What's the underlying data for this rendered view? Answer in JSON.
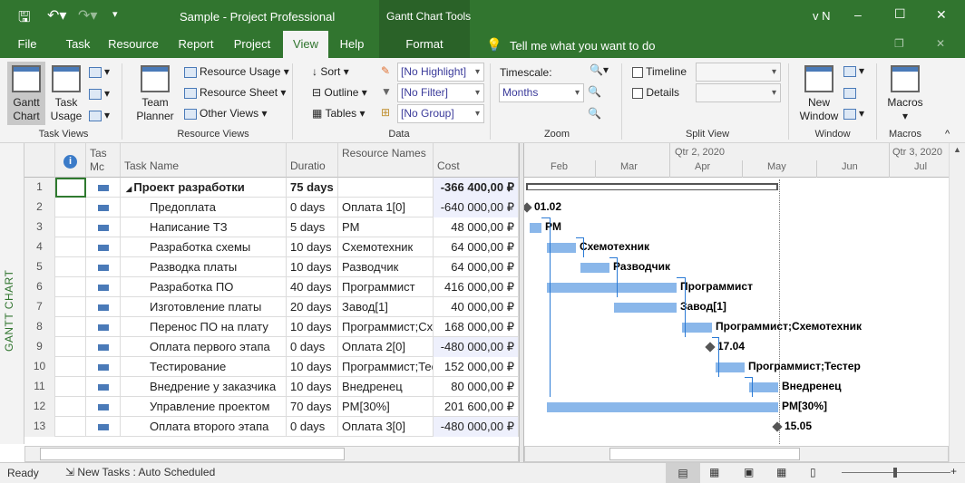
{
  "titlebar": {
    "title": "Sample  -  Project Professional",
    "context_title": "Gantt Chart Tools",
    "user": "v N",
    "minimize": "–",
    "maximize": "☐",
    "close": "✕"
  },
  "tabs": [
    {
      "label": "File"
    },
    {
      "label": "Task"
    },
    {
      "label": "Resource"
    },
    {
      "label": "Report"
    },
    {
      "label": "Project"
    },
    {
      "label": "View",
      "selected": true
    },
    {
      "label": "Help"
    },
    {
      "label": "Format"
    }
  ],
  "tell_me": "Tell me what you want to do",
  "ribbon": {
    "task_views": {
      "label": "Task Views",
      "gantt_chart": "Gantt Chart",
      "task_usage": "Task Usage"
    },
    "resource_views": {
      "label": "Resource Views",
      "team_planner": "Team Planner",
      "resource_usage": "Resource Usage",
      "resource_sheet": "Resource Sheet",
      "other_views": "Other Views"
    },
    "data": {
      "label": "Data",
      "sort": "Sort",
      "outline": "Outline",
      "tables": "Tables",
      "highlight": "[No Highlight]",
      "filter": "[No Filter]",
      "group": "[No Group]"
    },
    "zoom": {
      "label": "Zoom",
      "timescale_label": "Timescale:",
      "timescale": "Months"
    },
    "split_view": {
      "label": "Split View",
      "timeline": "Timeline",
      "details": "Details",
      "timeline_checked": false,
      "details_checked": false
    },
    "window": {
      "label": "Window",
      "new_window": "New Window"
    },
    "macros": {
      "label": "Macros",
      "macros": "Macros"
    }
  },
  "side_label": "GANTT CHART",
  "table": {
    "headers": {
      "info": "i",
      "mode": "Task Mode",
      "name": "Task Name",
      "duration": "Duration",
      "resources": "Resource Names",
      "cost": "Cost"
    },
    "header_display": {
      "mode": "Tas Mc",
      "duration": "Duratio",
      "resources": "Resource Names"
    },
    "rows": [
      {
        "id": "1",
        "name": "Проект разработки",
        "duration": "75 days",
        "resources": "",
        "cost": "-366 400,00 ₽",
        "summary": true
      },
      {
        "id": "2",
        "name": "Предоплата",
        "duration": "0 days",
        "resources": "Оплата 1[0]",
        "cost": "-640 000,00 ₽"
      },
      {
        "id": "3",
        "name": "Написание ТЗ",
        "duration": "5 days",
        "resources": "PM",
        "cost": "48 000,00 ₽"
      },
      {
        "id": "4",
        "name": "Разработка схемы",
        "duration": "10 days",
        "resources": "Схемотехник",
        "cost": "64 000,00 ₽"
      },
      {
        "id": "5",
        "name": "Разводка платы",
        "duration": "10 days",
        "resources": "Разводчик",
        "cost": "64 000,00 ₽"
      },
      {
        "id": "6",
        "name": "Разработка ПО",
        "duration": "40 days",
        "resources": "Программист",
        "cost": "416 000,00 ₽"
      },
      {
        "id": "7",
        "name": "Изготовление платы",
        "duration": "20 days",
        "resources": "Завод[1]",
        "cost": "40 000,00 ₽"
      },
      {
        "id": "8",
        "name": "Перенос ПО на плату",
        "duration": "10 days",
        "resources": "Программист;Схемотехник",
        "cost": "168 000,00 ₽"
      },
      {
        "id": "9",
        "name": "Оплата первого этапа",
        "duration": "0 days",
        "resources": "Оплата 2[0]",
        "cost": "-480 000,00 ₽"
      },
      {
        "id": "10",
        "name": "Тестирование",
        "duration": "10 days",
        "resources": "Программист;Тестер",
        "cost": "152 000,00 ₽"
      },
      {
        "id": "11",
        "name": "Внедрение у заказчика",
        "duration": "10 days",
        "resources": "Внедренец",
        "cost": "80 000,00 ₽"
      },
      {
        "id": "12",
        "name": "Управление проектом",
        "duration": "70 days",
        "resources": "PM[30%]",
        "cost": "201 600,00 ₽"
      },
      {
        "id": "13",
        "name": "Оплата второго этапа",
        "duration": "0 days",
        "resources": "Оплата 3[0]",
        "cost": "-480 000,00 ₽"
      }
    ]
  },
  "gantt": {
    "quarters": [
      "Qtr 2, 2020",
      "Qtr 3, 2020"
    ],
    "months": [
      "Feb",
      "Mar",
      "Apr",
      "May",
      "Jun",
      "Jul"
    ],
    "bar_labels": [
      "",
      "01.02",
      "PM",
      "Схемотехник",
      "Разводчик",
      "Программист",
      "Завод[1]",
      "Программист;Схемотехник",
      "17.04",
      "Программист;Тестер",
      "Внедренец",
      "PM[30%]",
      "15.05"
    ],
    "bar_color": "#8ab7ea",
    "link_color": "#2a7ad5"
  },
  "status": {
    "ready": "Ready",
    "new_tasks": "New Tasks : Auto Scheduled"
  },
  "colors": {
    "brand": "#31752f",
    "accent": "#4a7ab8"
  }
}
